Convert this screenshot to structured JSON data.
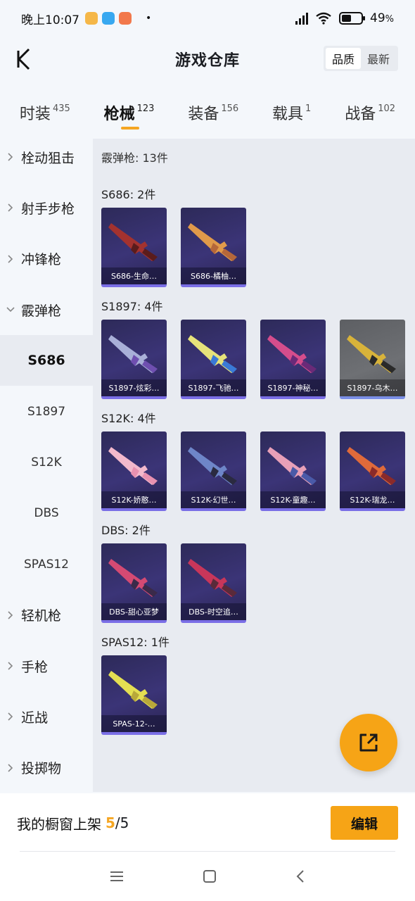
{
  "status": {
    "time": "晚上10:07",
    "battery": "49",
    "battery_unit": "%",
    "battery_level": 0.49
  },
  "header": {
    "title": "游戏仓库",
    "sort_options": [
      "品质",
      "最新"
    ],
    "active_sort": "品质"
  },
  "tabs": [
    {
      "label": "时装",
      "count": "435"
    },
    {
      "label": "枪械",
      "count": "123",
      "active": true
    },
    {
      "label": "装备",
      "count": "156"
    },
    {
      "label": "载具",
      "count": "1"
    },
    {
      "label": "战备",
      "count": "102"
    }
  ],
  "sidebar": {
    "items": [
      {
        "label": "栓动狙击",
        "expandable": true
      },
      {
        "label": "射手步枪",
        "expandable": true
      },
      {
        "label": "冲锋枪",
        "expandable": true
      },
      {
        "label": "霰弹枪",
        "expanded": true
      },
      {
        "label": "S686",
        "sub": true,
        "active": true
      },
      {
        "label": "S1897",
        "sub": true
      },
      {
        "label": "S12K",
        "sub": true
      },
      {
        "label": "DBS",
        "sub": true
      },
      {
        "label": "SPAS12",
        "sub": true
      },
      {
        "label": "轻机枪",
        "expandable": true
      },
      {
        "label": "手枪",
        "expandable": true
      },
      {
        "label": "近战",
        "expandable": true
      },
      {
        "label": "投掷物",
        "expandable": true
      }
    ]
  },
  "main": {
    "summary": "霰弹枪: 13件",
    "groups": [
      {
        "title": "S686: 2件",
        "items": [
          {
            "label": "S686-生命…",
            "gun": "#a3322f",
            "gun2": "#5a1c1c"
          },
          {
            "label": "S686-橘柚…",
            "gun": "#e09a4a",
            "gun2": "#b5673a"
          }
        ]
      },
      {
        "title": "S1897: 4件",
        "items": [
          {
            "label": "S1897-炫彩…",
            "gun": "#a9b0d8",
            "gun2": "#6f4fb0"
          },
          {
            "label": "S1897-飞驰…",
            "gun": "#e6e37a",
            "gun2": "#3a7ad6"
          },
          {
            "label": "S1897-神秘…",
            "gun": "#d54d8c",
            "gun2": "#6a2a78"
          },
          {
            "label": "S1897-乌木…",
            "gun": "#d8b33a",
            "gun2": "#2a2a2a",
            "grey": true
          }
        ]
      },
      {
        "title": "S12K: 4件",
        "items": [
          {
            "label": "S12K-娇憨…",
            "gun": "#f3b9cc",
            "gun2": "#e891b0"
          },
          {
            "label": "S12K-幻世…",
            "gun": "#6e86c8",
            "gun2": "#2a2a40"
          },
          {
            "label": "S12K-童趣…",
            "gun": "#e8a0b8",
            "gun2": "#4a5aa8"
          },
          {
            "label": "S12K-瑞龙…",
            "gun": "#e06a3a",
            "gun2": "#8a2a2a"
          }
        ]
      },
      {
        "title": "DBS: 2件",
        "items": [
          {
            "label": "DBS-甜心亚梦",
            "gun": "#d44a73",
            "gun2": "#3a2a4a"
          },
          {
            "label": "DBS-时空追…",
            "gun": "#c8365a",
            "gun2": "#5a2a3a"
          }
        ]
      },
      {
        "title": "SPAS12: 1件",
        "items": [
          {
            "label": "SPAS-12-…",
            "gun": "#e4df52",
            "gun2": "#b8a83a"
          }
        ]
      }
    ]
  },
  "bottom": {
    "showcase_label": "我的橱窗上架",
    "current": "5",
    "separator": "/",
    "total": "5",
    "edit_label": "编辑"
  },
  "colors": {
    "accent": "#f5a623",
    "card_bg": "#3b3477"
  }
}
